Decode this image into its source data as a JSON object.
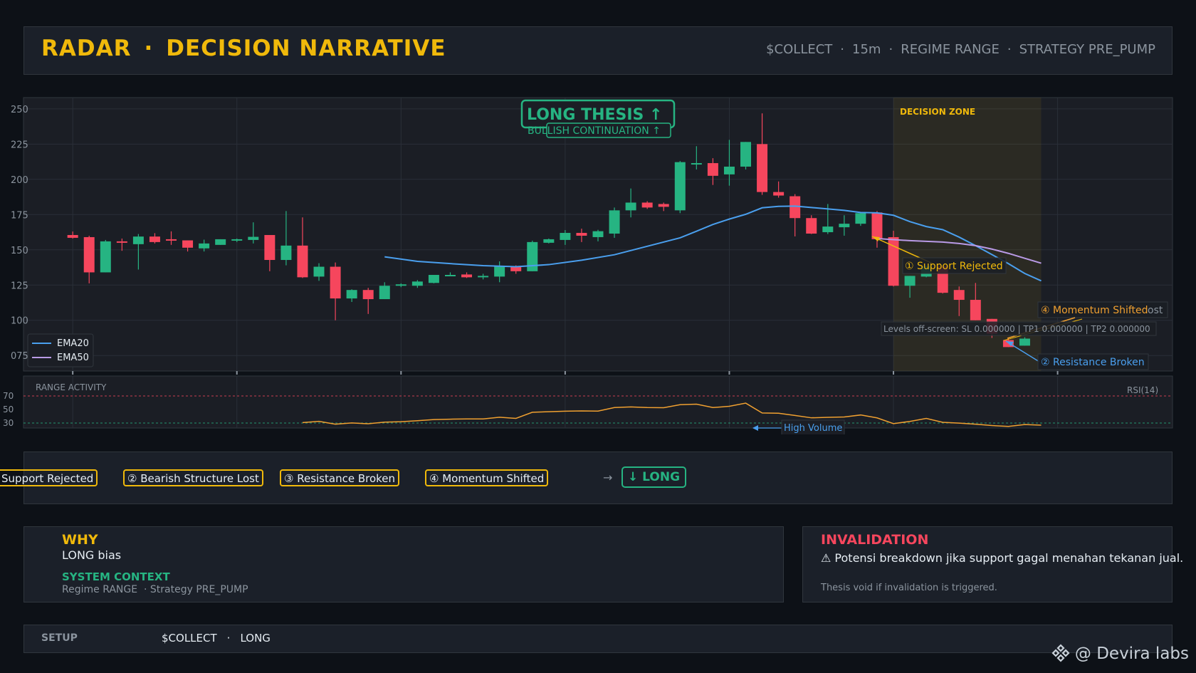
{
  "header": {
    "title_left": "RADAR",
    "title_sep": "·",
    "title_right": "DECISION NARRATIVE",
    "symbol": "$COLLECT",
    "timeframe": "15m",
    "regime": "REGIME RANGE",
    "strategy": "STRATEGY PRE_PUMP",
    "sep": "·"
  },
  "colors": {
    "accent": "#f0b90b",
    "bull": "#26b482",
    "bear": "#f6465d",
    "ema20": "#4a9fee",
    "ema50": "#b99ae6",
    "rsi": "#f0a030",
    "background": "#0d1117",
    "panel": "#1b2029"
  },
  "chart_data": {
    "type": "candlestick",
    "x_range": [
      -3,
      67
    ],
    "y_range": [
      6.64e-05,
      8.58e-05
    ],
    "y_tick_labels": [
      "250",
      "225",
      "200",
      "175",
      "150",
      "125",
      "100",
      "075"
    ],
    "y_tick_values": [
      8.5e-05,
      8.25e-05,
      8e-05,
      7.75e-05,
      7.5e-05,
      7.25e-05,
      7e-05,
      6.75e-05
    ],
    "x_ticks": [
      0,
      10,
      20,
      30,
      40,
      50,
      60
    ],
    "candles": [
      {
        "o": 7.605e-05,
        "h": 7.63e-05,
        "l": 7.58e-05,
        "c": 7.585e-05
      },
      {
        "o": 7.59e-05,
        "h": 7.6e-05,
        "l": 7.262e-05,
        "c": 7.34e-05
      },
      {
        "o": 7.34e-05,
        "h": 7.57e-05,
        "l": 7.34e-05,
        "c": 7.56e-05
      },
      {
        "o": 7.56e-05,
        "h": 7.58e-05,
        "l": 7.493e-05,
        "c": 7.55e-05
      },
      {
        "o": 7.54e-05,
        "h": 7.612e-05,
        "l": 7.36e-05,
        "c": 7.594e-05
      },
      {
        "o": 7.594e-05,
        "h": 7.618e-05,
        "l": 7.545e-05,
        "c": 7.555e-05
      },
      {
        "o": 7.575e-05,
        "h": 7.631e-05,
        "l": 7.535e-05,
        "c": 7.565e-05
      },
      {
        "o": 7.567e-05,
        "h": 7.567e-05,
        "l": 7.488e-05,
        "c": 7.515e-05
      },
      {
        "o": 7.51e-05,
        "h": 7.572e-05,
        "l": 7.488e-05,
        "c": 7.545e-05
      },
      {
        "o": 7.535e-05,
        "h": 7.575e-05,
        "l": 7.535e-05,
        "c": 7.575e-05
      },
      {
        "o": 7.565e-05,
        "h": 7.58e-05,
        "l": 7.555e-05,
        "c": 7.575e-05
      },
      {
        "o": 7.57e-05,
        "h": 7.695e-05,
        "l": 7.545e-05,
        "c": 7.592e-05
      },
      {
        "o": 7.605e-05,
        "h": 7.605e-05,
        "l": 7.348e-05,
        "c": 7.428e-05
      },
      {
        "o": 7.428e-05,
        "h": 7.775e-05,
        "l": 7.39e-05,
        "c": 7.53e-05
      },
      {
        "o": 7.53e-05,
        "h": 7.73e-05,
        "l": 7.3e-05,
        "c": 7.305e-05
      },
      {
        "o": 7.31e-05,
        "h": 7.405e-05,
        "l": 7.28e-05,
        "c": 7.38e-05
      },
      {
        "o": 7.38e-05,
        "h": 7.41e-05,
        "l": 7e-05,
        "c": 7.155e-05
      },
      {
        "o": 7.155e-05,
        "h": 7.22e-05,
        "l": 7.13e-05,
        "c": 7.215e-05
      },
      {
        "o": 7.215e-05,
        "h": 7.23e-05,
        "l": 7.045e-05,
        "c": 7.15e-05
      },
      {
        "o": 7.15e-05,
        "h": 7.27e-05,
        "l": 7.15e-05,
        "c": 7.245e-05
      },
      {
        "o": 7.245e-05,
        "h": 7.262e-05,
        "l": 7.235e-05,
        "c": 7.255e-05
      },
      {
        "o": 7.245e-05,
        "h": 7.285e-05,
        "l": 7.23e-05,
        "c": 7.275e-05
      },
      {
        "o": 7.265e-05,
        "h": 7.322e-05,
        "l": 7.262e-05,
        "c": 7.322e-05
      },
      {
        "o": 7.322e-05,
        "h": 7.34e-05,
        "l": 7.315e-05,
        "c": 7.322e-05
      },
      {
        "o": 7.325e-05,
        "h": 7.34e-05,
        "l": 7.3e-05,
        "c": 7.305e-05
      },
      {
        "o": 7.305e-05,
        "h": 7.33e-05,
        "l": 7.29e-05,
        "c": 7.315e-05
      },
      {
        "o": 7.31e-05,
        "h": 7.418e-05,
        "l": 7.27e-05,
        "c": 7.38e-05
      },
      {
        "o": 7.38e-05,
        "h": 7.39e-05,
        "l": 7.33e-05,
        "c": 7.348e-05
      },
      {
        "o": 7.348e-05,
        "h": 7.565e-05,
        "l": 7.348e-05,
        "c": 7.555e-05
      },
      {
        "o": 7.55e-05,
        "h": 7.58e-05,
        "l": 7.545e-05,
        "c": 7.575e-05
      },
      {
        "o": 7.57e-05,
        "h": 7.64e-05,
        "l": 7.535e-05,
        "c": 7.62e-05
      },
      {
        "o": 7.62e-05,
        "h": 7.65e-05,
        "l": 7.555e-05,
        "c": 7.6e-05
      },
      {
        "o": 7.59e-05,
        "h": 7.642e-05,
        "l": 7.56e-05,
        "c": 7.632e-05
      },
      {
        "o": 7.615e-05,
        "h": 7.8e-05,
        "l": 7.585e-05,
        "c": 7.78e-05
      },
      {
        "o": 7.78e-05,
        "h": 7.935e-05,
        "l": 7.73e-05,
        "c": 7.835e-05
      },
      {
        "o": 7.835e-05,
        "h": 7.845e-05,
        "l": 7.79e-05,
        "c": 7.8e-05
      },
      {
        "o": 7.825e-05,
        "h": 7.835e-05,
        "l": 7.775e-05,
        "c": 7.805e-05
      },
      {
        "o": 7.78e-05,
        "h": 8.13e-05,
        "l": 7.76e-05,
        "c": 8.122e-05
      },
      {
        "o": 8.115e-05,
        "h": 8.235e-05,
        "l": 8.07e-05,
        "c": 8.115e-05
      },
      {
        "o": 8.115e-05,
        "h": 8.15e-05,
        "l": 7.96e-05,
        "c": 8.025e-05
      },
      {
        "o": 8.035e-05,
        "h": 8.28e-05,
        "l": 7.955e-05,
        "c": 8.09e-05
      },
      {
        "o": 8.09e-05,
        "h": 8.265e-05,
        "l": 8.07e-05,
        "c": 8.265e-05
      },
      {
        "o": 8.25e-05,
        "h": 8.468e-05,
        "l": 7.89e-05,
        "c": 7.91e-05
      },
      {
        "o": 7.91e-05,
        "h": 7.985e-05,
        "l": 7.87e-05,
        "c": 7.885e-05
      },
      {
        "o": 7.88e-05,
        "h": 7.895e-05,
        "l": 7.595e-05,
        "c": 7.725e-05
      },
      {
        "o": 7.725e-05,
        "h": 7.745e-05,
        "l": 7.612e-05,
        "c": 7.615e-05
      },
      {
        "o": 7.625e-05,
        "h": 7.825e-05,
        "l": 7.612e-05,
        "c": 7.665e-05
      },
      {
        "o": 7.66e-05,
        "h": 7.745e-05,
        "l": 7.6e-05,
        "c": 7.685e-05
      },
      {
        "o": 7.685e-05,
        "h": 7.765e-05,
        "l": 7.67e-05,
        "c": 7.76e-05
      },
      {
        "o": 7.765e-05,
        "h": 7.775e-05,
        "l": 7.515e-05,
        "c": 7.575e-05
      },
      {
        "o": 7.59e-05,
        "h": 7.635e-05,
        "l": 7.24e-05,
        "c": 7.245e-05
      },
      {
        "o": 7.245e-05,
        "h": 7.315e-05,
        "l": 7.16e-05,
        "c": 7.315e-05
      },
      {
        "o": 7.31e-05,
        "h": 7.388e-05,
        "l": 7.305e-05,
        "c": 7.385e-05
      },
      {
        "o": 7.385e-05,
        "h": 7.385e-05,
        "l": 7.19e-05,
        "c": 7.195e-05
      },
      {
        "o": 7.215e-05,
        "h": 7.24e-05,
        "l": 7.03e-05,
        "c": 7.145e-05
      },
      {
        "o": 7.145e-05,
        "h": 7.265e-05,
        "l": 7e-05,
        "c": 7e-05
      },
      {
        "o": 7.01e-05,
        "h": 7.01e-05,
        "l": 6.875e-05,
        "c": 6.905e-05
      },
      {
        "o": 6.86e-05,
        "h": 6.875e-05,
        "l": 6.81e-05,
        "c": 6.81e-05
      },
      {
        "o": 6.82e-05,
        "h": 6.88e-05,
        "l": 6.82e-05,
        "c": 6.87e-05
      }
    ],
    "ema20": [
      [
        19,
        7.45e-05
      ],
      [
        21,
        7.418e-05
      ],
      [
        23,
        7.402e-05
      ],
      [
        25,
        7.388e-05
      ],
      [
        27,
        7.38e-05
      ],
      [
        29,
        7.395e-05
      ],
      [
        31,
        7.426e-05
      ],
      [
        33,
        7.465e-05
      ],
      [
        35,
        7.525e-05
      ],
      [
        37,
        7.585e-05
      ],
      [
        38,
        7.632e-05
      ],
      [
        39,
        7.68e-05
      ],
      [
        40,
        7.718e-05
      ],
      [
        41,
        7.752e-05
      ],
      [
        42,
        7.798e-05
      ],
      [
        43,
        7.808e-05
      ],
      [
        44,
        7.81e-05
      ],
      [
        45,
        7.8e-05
      ],
      [
        47,
        7.78e-05
      ],
      [
        48,
        7.765e-05
      ],
      [
        49,
        7.762e-05
      ],
      [
        50,
        7.745e-05
      ],
      [
        51,
        7.7e-05
      ],
      [
        52,
        7.665e-05
      ],
      [
        53,
        7.643e-05
      ],
      [
        54,
        7.59e-05
      ],
      [
        55,
        7.53e-05
      ],
      [
        57,
        7.402e-05
      ],
      [
        58,
        7.332e-05
      ],
      [
        59,
        7.28e-05
      ]
    ],
    "ema50": [
      [
        49,
        7.58e-05
      ],
      [
        50,
        7.572e-05
      ],
      [
        51,
        7.565e-05
      ],
      [
        52,
        7.56e-05
      ],
      [
        53,
        7.555e-05
      ],
      [
        54,
        7.545e-05
      ],
      [
        55,
        7.53e-05
      ],
      [
        56,
        7.505e-05
      ],
      [
        57,
        7.475e-05
      ],
      [
        58,
        7.44e-05
      ],
      [
        59,
        7.405e-05
      ]
    ],
    "rsi_levels": [
      70,
      50,
      30
    ],
    "rsi": [
      [
        14,
        30.6
      ],
      [
        15,
        32.5
      ],
      [
        16,
        28.3
      ],
      [
        17,
        30.1
      ],
      [
        18,
        28.9
      ],
      [
        19,
        31.3
      ],
      [
        20,
        32.0
      ],
      [
        21,
        33.4
      ],
      [
        22,
        35.1
      ],
      [
        23,
        35.7
      ],
      [
        24,
        36.0
      ],
      [
        25,
        36.1
      ],
      [
        26,
        38.5
      ],
      [
        27,
        36.9
      ],
      [
        28,
        45.9
      ],
      [
        29,
        46.7
      ],
      [
        30,
        47.5
      ],
      [
        31,
        47.9
      ],
      [
        32,
        47.6
      ],
      [
        33,
        52.9
      ],
      [
        34,
        53.8
      ],
      [
        35,
        52.9
      ],
      [
        36,
        52.6
      ],
      [
        37,
        57.1
      ],
      [
        38,
        57.9
      ],
      [
        39,
        52.9
      ],
      [
        40,
        54.7
      ],
      [
        41,
        59.4
      ],
      [
        42,
        44.9
      ],
      [
        43,
        44.5
      ],
      [
        44,
        41.2
      ],
      [
        45,
        37.7
      ],
      [
        46,
        38.4
      ],
      [
        47,
        39.0
      ],
      [
        48,
        41.9
      ],
      [
        49,
        37.6
      ],
      [
        50,
        29.1
      ],
      [
        51,
        32.4
      ],
      [
        52,
        36.8
      ],
      [
        53,
        31.1
      ],
      [
        54,
        29.9
      ],
      [
        55,
        28.3
      ],
      [
        56,
        26.3
      ],
      [
        57,
        25.0
      ],
      [
        58,
        27.8
      ],
      [
        59,
        26.9
      ]
    ],
    "legend": [
      "EMA20",
      "EMA50"
    ],
    "legend_position": "bottom-left",
    "decision_zone": [
      50,
      59
    ],
    "grid": true,
    "labels": {
      "decision_zone": "DECISION ZONE",
      "range_activity": "RANGE ACTIVITY",
      "rsi": "RSI(14)",
      "thesis": "LONG THESIS ↑",
      "thesis_sub": "BULLISH CONTINUATION ↑",
      "support_rejected": "① Support Rejected",
      "momentum_shifted": "④ Momentum Shifted",
      "momentum_overlap": "ost",
      "resistance_broken": "② Resistance Broken",
      "levels": "Levels off-screen: SL 0.000000 | TP1 0.000000 | TP2 0.000000",
      "high_volume": "High Volume"
    }
  },
  "flow": {
    "chips": [
      "Support Rejected",
      "② Bearish Structure Lost",
      "③ Resistance Broken",
      "④ Momentum Shifted"
    ],
    "arrow": "→",
    "result": "↓ LONG"
  },
  "why": {
    "title": "WHY",
    "body": "LONG bias",
    "context_title": "SYSTEM CONTEXT",
    "context_body": "Regime RANGE  · Strategy PRE_PUMP"
  },
  "invalidation": {
    "title": "INVALIDATION",
    "body": "⚠ Potensi breakdown jika support gagal menahan tekanan jual.",
    "note": "Thesis void if invalidation is triggered."
  },
  "setup": {
    "label": "SETUP",
    "symbol": "$COLLECT",
    "sep": "·",
    "side": "LONG"
  },
  "watermark": {
    "text": "@ Devira labs",
    "icon": "binance-diamond-icon"
  }
}
